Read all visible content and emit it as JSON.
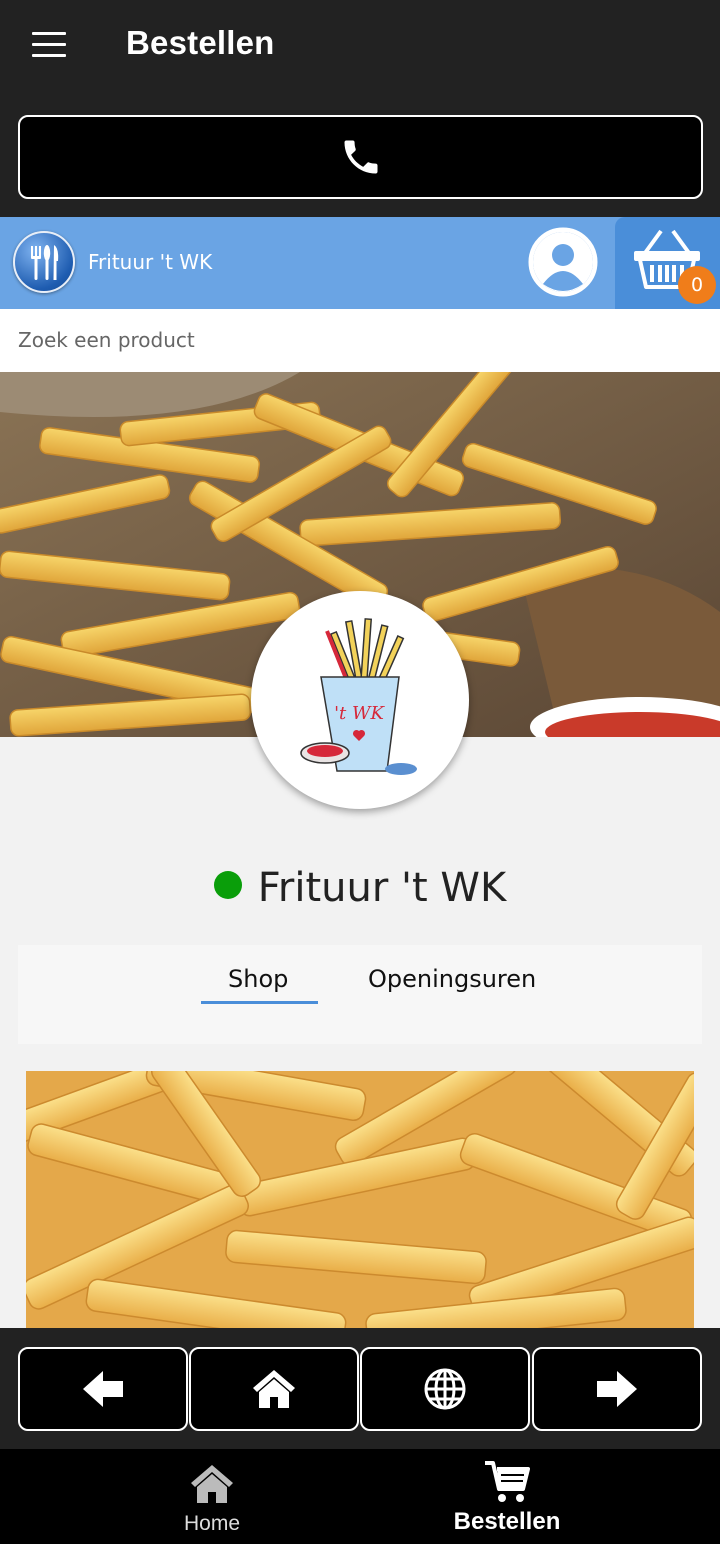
{
  "header": {
    "title": "Bestellen"
  },
  "call_button": {
    "icon": "phone-icon"
  },
  "shop_bar": {
    "name": "Frituur 't WK",
    "cart_count": "0"
  },
  "search": {
    "placeholder": "Zoek een product"
  },
  "store": {
    "title": "Frituur 't WK",
    "status_color": "#0a9e0a",
    "logo_text": "'t WK"
  },
  "tabs": [
    {
      "label": "Shop",
      "active": true
    },
    {
      "label": "Openingsuren",
      "active": false
    }
  ],
  "nav_buttons": [
    "back-arrow-icon",
    "home-icon",
    "globe-icon",
    "forward-arrow-icon"
  ],
  "bottom_nav": [
    {
      "label": "Home",
      "active": false
    },
    {
      "label": "Bestellen",
      "active": true
    }
  ],
  "colors": {
    "topbar": "#222222",
    "shopbar": "#6aa4e4",
    "accent": "#4a8ed9",
    "badge": "#f07d1a"
  }
}
